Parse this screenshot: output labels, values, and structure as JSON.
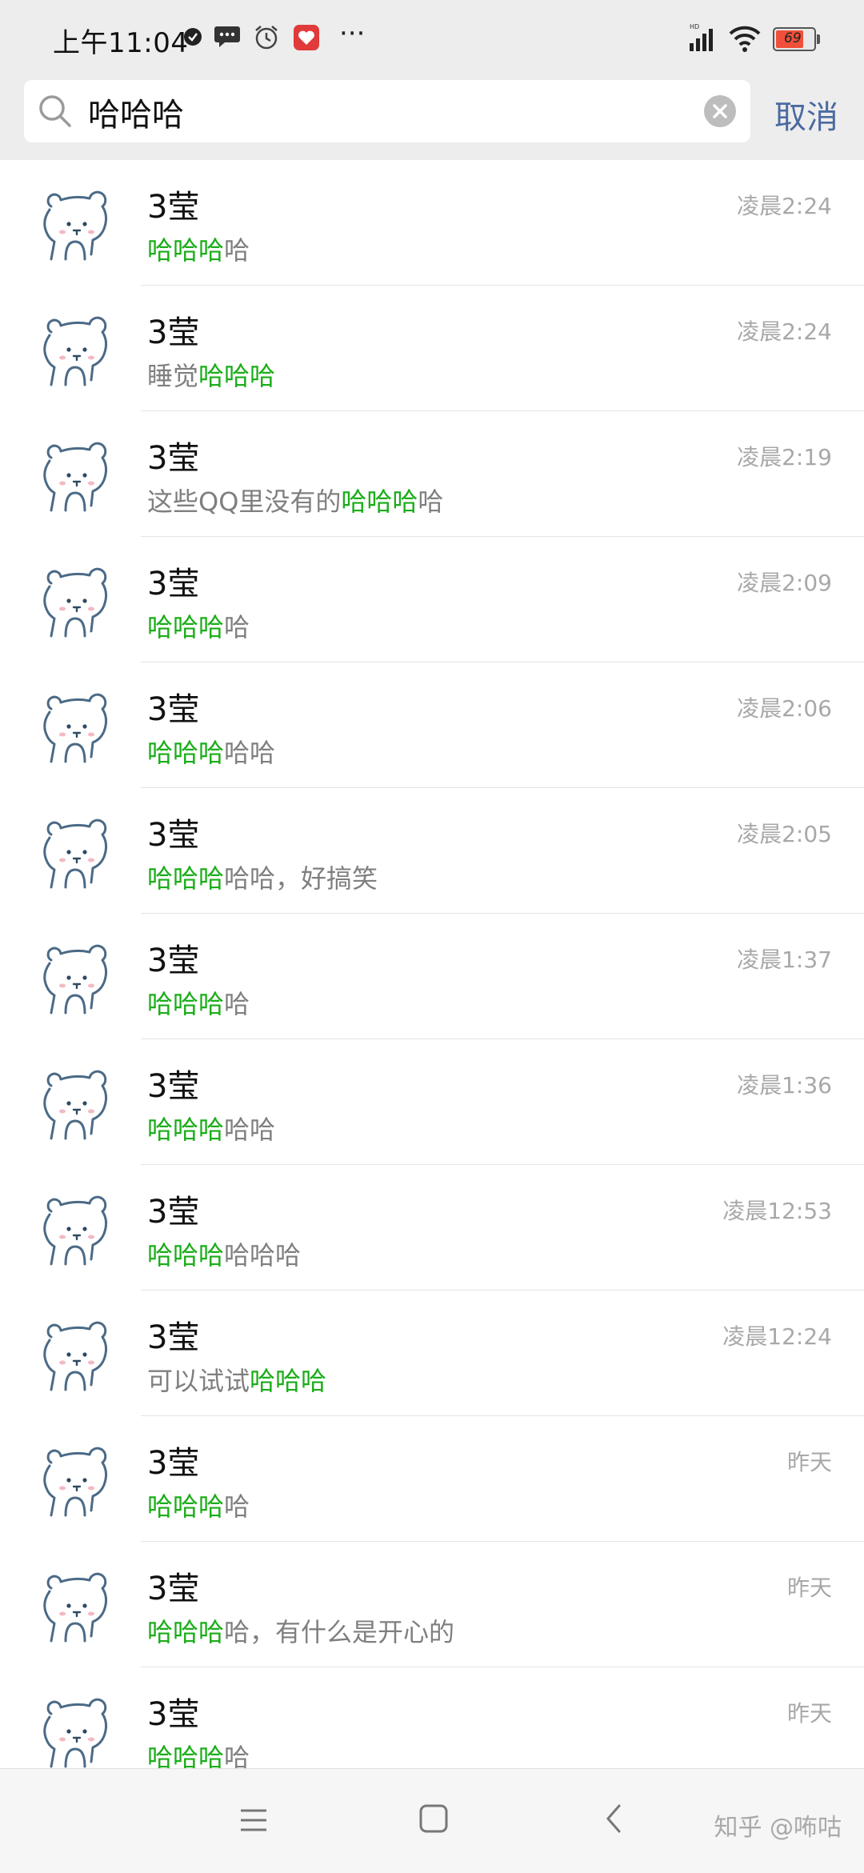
{
  "status_bar": {
    "time": "上午11:04",
    "more": "···",
    "battery": "69",
    "hd": "HD"
  },
  "search": {
    "query": "哈哈哈",
    "cancel_label": "取消"
  },
  "results": [
    {
      "name": "3莹",
      "time": "凌晨2:24",
      "pre": "",
      "match": "哈哈哈",
      "post": "哈"
    },
    {
      "name": "3莹",
      "time": "凌晨2:24",
      "pre": "睡觉",
      "match": "哈哈哈",
      "post": ""
    },
    {
      "name": "3莹",
      "time": "凌晨2:19",
      "pre": "这些QQ里没有的",
      "match": "哈哈哈",
      "post": "哈"
    },
    {
      "name": "3莹",
      "time": "凌晨2:09",
      "pre": "",
      "match": "哈哈哈",
      "post": "哈"
    },
    {
      "name": "3莹",
      "time": "凌晨2:06",
      "pre": "",
      "match": "哈哈哈",
      "post": "哈哈"
    },
    {
      "name": "3莹",
      "time": "凌晨2:05",
      "pre": "",
      "match": "哈哈哈",
      "post": "哈哈，好搞笑"
    },
    {
      "name": "3莹",
      "time": "凌晨1:37",
      "pre": "",
      "match": "哈哈哈",
      "post": "哈"
    },
    {
      "name": "3莹",
      "time": "凌晨1:36",
      "pre": "",
      "match": "哈哈哈",
      "post": "哈哈"
    },
    {
      "name": "3莹",
      "time": "凌晨12:53",
      "pre": "",
      "match": "哈哈哈",
      "post": "哈哈哈"
    },
    {
      "name": "3莹",
      "time": "凌晨12:24",
      "pre": "可以试试",
      "match": "哈哈哈",
      "post": ""
    },
    {
      "name": "3莹",
      "time": "昨天",
      "pre": "",
      "match": "哈哈哈",
      "post": "哈"
    },
    {
      "name": "3莹",
      "time": "昨天",
      "pre": "",
      "match": "哈哈哈",
      "post": "哈，有什么是开心的"
    },
    {
      "name": "3莹",
      "time": "昨天",
      "pre": "",
      "match": "哈哈哈",
      "post": "哈"
    }
  ],
  "colors": {
    "highlight": "#1aad19",
    "link": "#4c6aa1",
    "header_bg": "#ededed"
  },
  "icons": {
    "search": "search-icon",
    "clear": "clear-icon",
    "avatar": "bear-avatar-icon",
    "menu": "menu-icon",
    "home": "home-icon",
    "back": "back-icon"
  },
  "watermark": "知乎 @咘咕"
}
